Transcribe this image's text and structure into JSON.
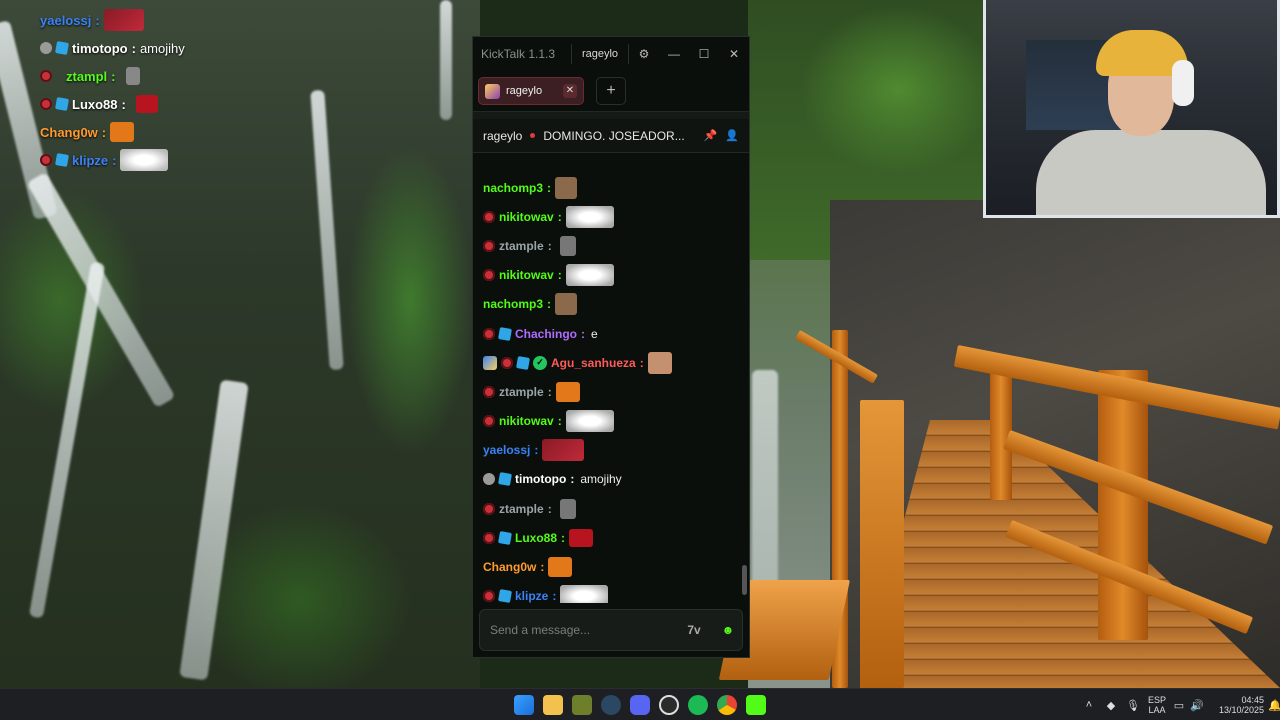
{
  "overlay": {
    "messages": [
      {
        "name": "yaelossj",
        "sep": ":",
        "text": "",
        "color": "#3b82f6",
        "emote": "maroon"
      },
      {
        "name": "timotopo",
        "sep": ":",
        "text": "amojihy",
        "color": "#ffffff",
        "emote": ""
      },
      {
        "name": "ztampl",
        "sep": ":",
        "text": "",
        "color": "#53fc18",
        "emote": "small"
      },
      {
        "name": "Luxo88",
        "sep": ":",
        "text": "",
        "color": "#ffffff",
        "emote": "red"
      },
      {
        "name": "Chang0w",
        "sep": ":",
        "text": "",
        "color": "#ff9a2e",
        "emote": "orange"
      },
      {
        "name": "klipze",
        "sep": ":",
        "text": "",
        "color": "#3b82f6",
        "emote": "white"
      }
    ]
  },
  "kicktalk": {
    "app_title": "KickTalk 1.1.3",
    "title_channel": "rageylo",
    "tab_label": "rageylo",
    "channel_name": "rageylo",
    "stream_title": "DOMINGO. JOSEADOR...",
    "messages": [
      {
        "name": "nachomp3",
        "sep": ":",
        "text": "",
        "color": "#53fc18"
      },
      {
        "name": "nikitowav",
        "sep": ":",
        "text": "",
        "color": "#53fc18"
      },
      {
        "name": "ztample",
        "sep": ":",
        "text": "",
        "color": "#9aa3a8"
      },
      {
        "name": "nikitowav",
        "sep": ":",
        "text": "",
        "color": "#53fc18"
      },
      {
        "name": "nachomp3",
        "sep": ":",
        "text": "",
        "color": "#53fc18"
      },
      {
        "name": "Chachingo",
        "sep": ":",
        "text": "e",
        "color": "#b06bff"
      },
      {
        "name": "Agu_sanhueza",
        "sep": ":",
        "text": "",
        "color": "#ff5a5a"
      },
      {
        "name": "ztample",
        "sep": ":",
        "text": "",
        "color": "#9aa3a8"
      },
      {
        "name": "nikitowav",
        "sep": ":",
        "text": "",
        "color": "#53fc18"
      },
      {
        "name": "yaelossj",
        "sep": ":",
        "text": "",
        "color": "#3b82f6"
      },
      {
        "name": "timotopo",
        "sep": ":",
        "text": "amojihy",
        "color": "#ffffff"
      },
      {
        "name": "ztample",
        "sep": ":",
        "text": "",
        "color": "#9aa3a8"
      },
      {
        "name": "Luxo88",
        "sep": ":",
        "text": "",
        "color": "#53fc18"
      },
      {
        "name": "Chang0w",
        "sep": ":",
        "text": "",
        "color": "#ff9a2e"
      },
      {
        "name": "klipze",
        "sep": ":",
        "text": "",
        "color": "#3b82f6"
      }
    ],
    "input_placeholder": "Send a message...",
    "accent": "#53fc18"
  },
  "taskbar": {
    "lang_top": "ESP",
    "lang_bottom": "LAA",
    "time": "04:45",
    "date": "13/10/2025"
  }
}
